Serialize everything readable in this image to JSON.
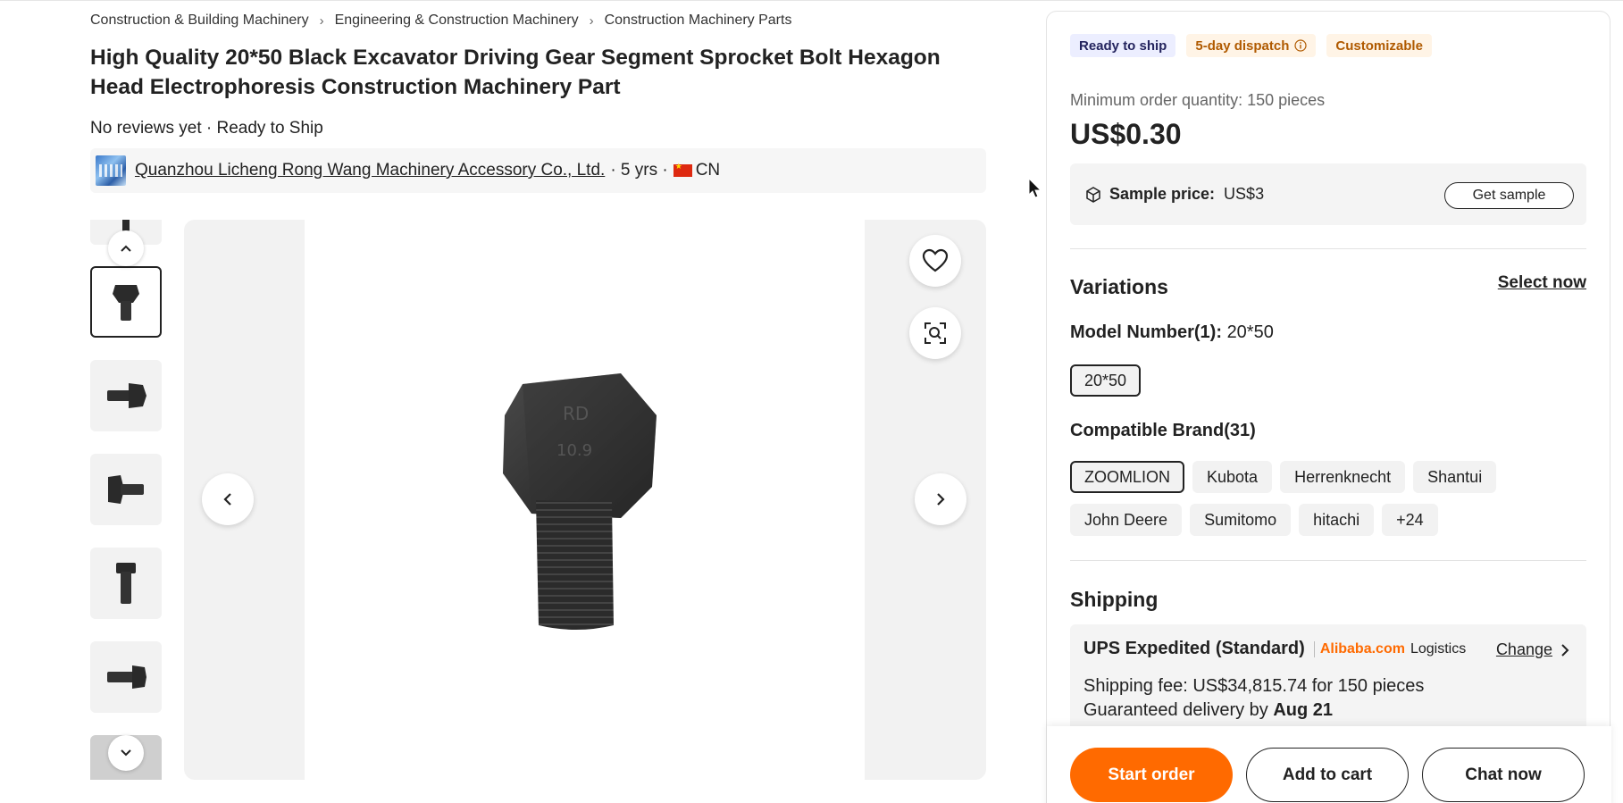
{
  "breadcrumb": [
    "Construction & Building Machinery",
    "Engineering & Construction Machinery",
    "Construction Machinery Parts"
  ],
  "product": {
    "title": "High Quality 20*50 Black Excavator Driving Gear Segment Sprocket Bolt Hexagon Head Electrophoresis Construction Machinery Part",
    "reviews_text": "No reviews yet · Ready to Ship"
  },
  "supplier": {
    "name": "Quanzhou Licheng Rong Wang Machinery Accessory Co., Ltd.",
    "years": "· 5 yrs ·",
    "country": "CN"
  },
  "gallery": {
    "favorite_icon": "heart-icon",
    "visual_search_icon": "image-search-icon",
    "prev_icon": "chevron-left-icon",
    "next_icon": "chevron-right-icon"
  },
  "panel": {
    "badges": {
      "ready": "Ready to ship",
      "dispatch": "5-day dispatch",
      "custom": "Customizable"
    },
    "moq": "Minimum order quantity: 150 pieces",
    "price": "US$0.30",
    "sample": {
      "label": "Sample price:",
      "value": "US$3",
      "button": "Get sample"
    },
    "variations": {
      "title": "Variations",
      "select_now": "Select now",
      "model_label": "Model Number(1):",
      "model_value": "20*50",
      "model_options": [
        "20*50"
      ],
      "brand_label": "Compatible Brand(31)",
      "brand_options": [
        "ZOOMLION",
        "Kubota",
        "Herrenknecht",
        "Shantui",
        "John Deere",
        "Sumitomo",
        "hitachi",
        "+24"
      ]
    },
    "shipping": {
      "title": "Shipping",
      "method": "UPS Expedited (Standard)",
      "logistics_brand": "Alibaba.com",
      "logistics_word": "Logistics",
      "change": "Change",
      "fee": "Shipping fee: US$34,815.74 for 150 pieces",
      "delivery_prefix": "Guaranteed delivery by",
      "delivery_date": "Aug 21"
    },
    "actions": {
      "start_order": "Start order",
      "add_to_cart": "Add to cart",
      "chat_now": "Chat now"
    }
  },
  "colors": {
    "accent": "#ff6a00",
    "text": "#222222",
    "muted": "#666666",
    "chip_bg": "#f2f2f2"
  }
}
